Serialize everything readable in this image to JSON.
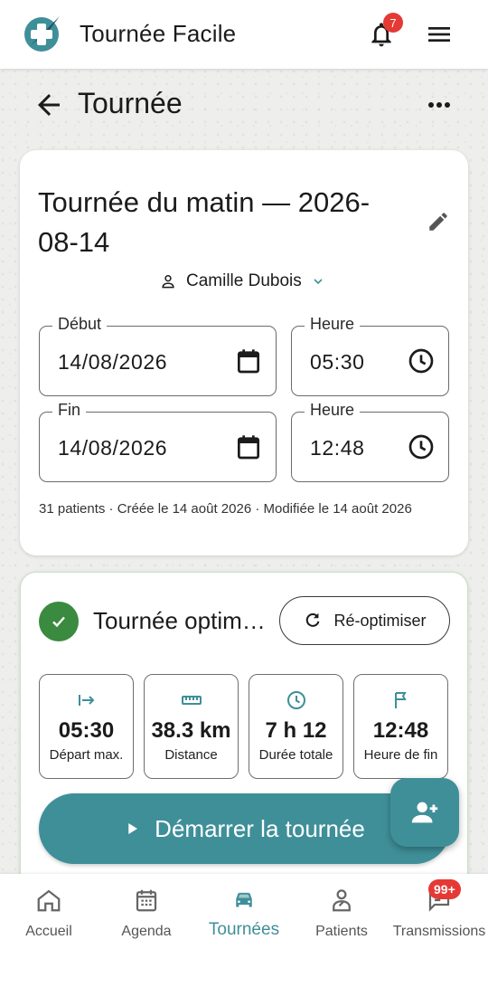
{
  "app": {
    "title": "Tournée Facile",
    "notification_count": "7",
    "colors": {
      "accent": "#3f8f99",
      "success": "#3a8a3f",
      "badge": "#e53935"
    }
  },
  "page": {
    "title": "Tournée"
  },
  "tour": {
    "title": "Tournée du matin — 2026-08-14",
    "nurse": "Camille Dubois",
    "start_label": "Début",
    "start_date": "14/08/2026",
    "start_time_label": "Heure",
    "start_time": "05:30",
    "end_label": "Fin",
    "end_date": "14/08/2026",
    "end_time_label": "Heure",
    "end_time": "12:48",
    "meta": "31 patients · Créée le 14 août 2026 · Modifiée le 14 août 2026"
  },
  "optimization": {
    "status": "Tournée optimisée",
    "reoptimize_label": "Ré-optimiser",
    "stats": [
      {
        "icon": "departure-icon",
        "value": "05:30",
        "label": "Départ max."
      },
      {
        "icon": "ruler-icon",
        "value": "38.3 km",
        "label": "Distance"
      },
      {
        "icon": "clock-icon",
        "value": "7 h 12",
        "label": "Durée totale"
      },
      {
        "icon": "flag-icon",
        "value": "12:48",
        "label": "Heure de fin"
      }
    ],
    "start_label": "Démarrer la tournée"
  },
  "nav": {
    "items": [
      {
        "label": "Accueil",
        "icon": "home-icon"
      },
      {
        "label": "Agenda",
        "icon": "calendar-icon"
      },
      {
        "label": "Tournées",
        "icon": "car-icon",
        "active": true
      },
      {
        "label": "Patients",
        "icon": "patient-icon"
      },
      {
        "label": "Transmissions",
        "icon": "chat-icon"
      }
    ],
    "transmissions_badge": "99+"
  }
}
